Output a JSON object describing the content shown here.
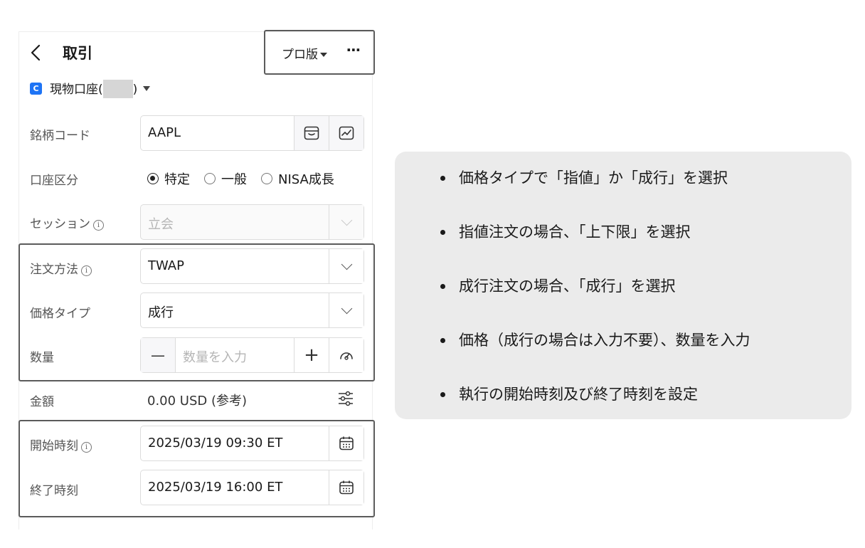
{
  "header": {
    "title": "取引",
    "pro_label": "プロ版",
    "more_label": "⋯"
  },
  "account": {
    "icon_text": "C",
    "label_prefix": "現物口座(",
    "label_suffix": ")"
  },
  "form": {
    "symbol": {
      "label": "銘柄コード",
      "value": "AAPL"
    },
    "account_type": {
      "label": "口座区分",
      "options": [
        "特定",
        "一般",
        "NISA成長"
      ],
      "selected": "特定"
    },
    "session": {
      "label": "セッション",
      "placeholder": "立会"
    },
    "order_method": {
      "label": "注文方法",
      "value": "TWAP"
    },
    "price_type": {
      "label": "価格タイプ",
      "value": "成行"
    },
    "quantity": {
      "label": "数量",
      "placeholder": "数量を入力",
      "minus": "—",
      "plus": "+"
    },
    "amount": {
      "label": "金額",
      "value": "0.00 USD (参考)"
    },
    "start_time": {
      "label": "開始時刻",
      "value": "2025/03/19 09:30 ET"
    },
    "end_time": {
      "label": "終了時刻",
      "value": "2025/03/19 16:00 ET"
    },
    "info_glyph": "i"
  },
  "callout": {
    "items": [
      "価格タイプで「指値」か「成行」を選択",
      "指値注文の場合、「上下限」を選択",
      "成行注文の場合、「成行」を選択",
      "価格（成行の場合は入力不要）、数量を入力",
      "執行の開始時刻及び終了時刻を設定"
    ]
  },
  "colors": {
    "accent": "#1e74f5",
    "highlight_border": "#5b5b5b",
    "callout_bg": "#ebebeb"
  }
}
